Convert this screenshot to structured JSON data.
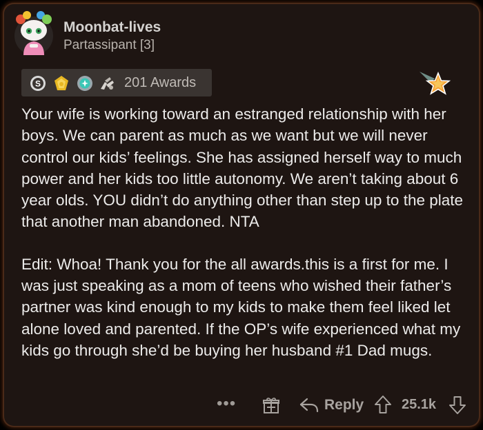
{
  "comment": {
    "username": "Moonbat-lives",
    "flair": "Partassipant [3]",
    "awards_count_label": "201 Awards",
    "paragraphs": [
      "Your wife is working toward an estranged relationship with her boys. We can parent as much as we want but we will never control our kids’ feelings. She has assigned herself way to much power and her kids too little autonomy. We aren’t taking about 6 year olds. YOU didn’t do anything other than step up to the plate that another man abandoned. NTA",
      "Edit: Whoa! Thank you for the all awards.this is a first for me.  I was just speaking as a mom of teens who wished their father’s partner was kind enough to my kids to make them feel liked let alone loved and parented.  If the OP’s wife experienced what my kids go through she’d be buying her husband #1 Dad mugs."
    ]
  },
  "actions": {
    "more_label": "•••",
    "reply_label": "Reply",
    "score": "25.1k"
  },
  "icons": {
    "avatar": "snoo-avatar-icon",
    "awards": [
      "silver-award-icon",
      "gold-award-icon",
      "platinum-award-icon",
      "hands-award-icon"
    ],
    "star": "star-badge-icon",
    "gift": "gift-icon",
    "reply": "reply-arrow-icon",
    "upvote": "upvote-arrow-icon",
    "downvote": "downvote-arrow-icon"
  },
  "colors": {
    "background": "#1e1512",
    "border_glow": "#4a2a18",
    "text": "#ecebea",
    "muted": "#a8a39f"
  }
}
